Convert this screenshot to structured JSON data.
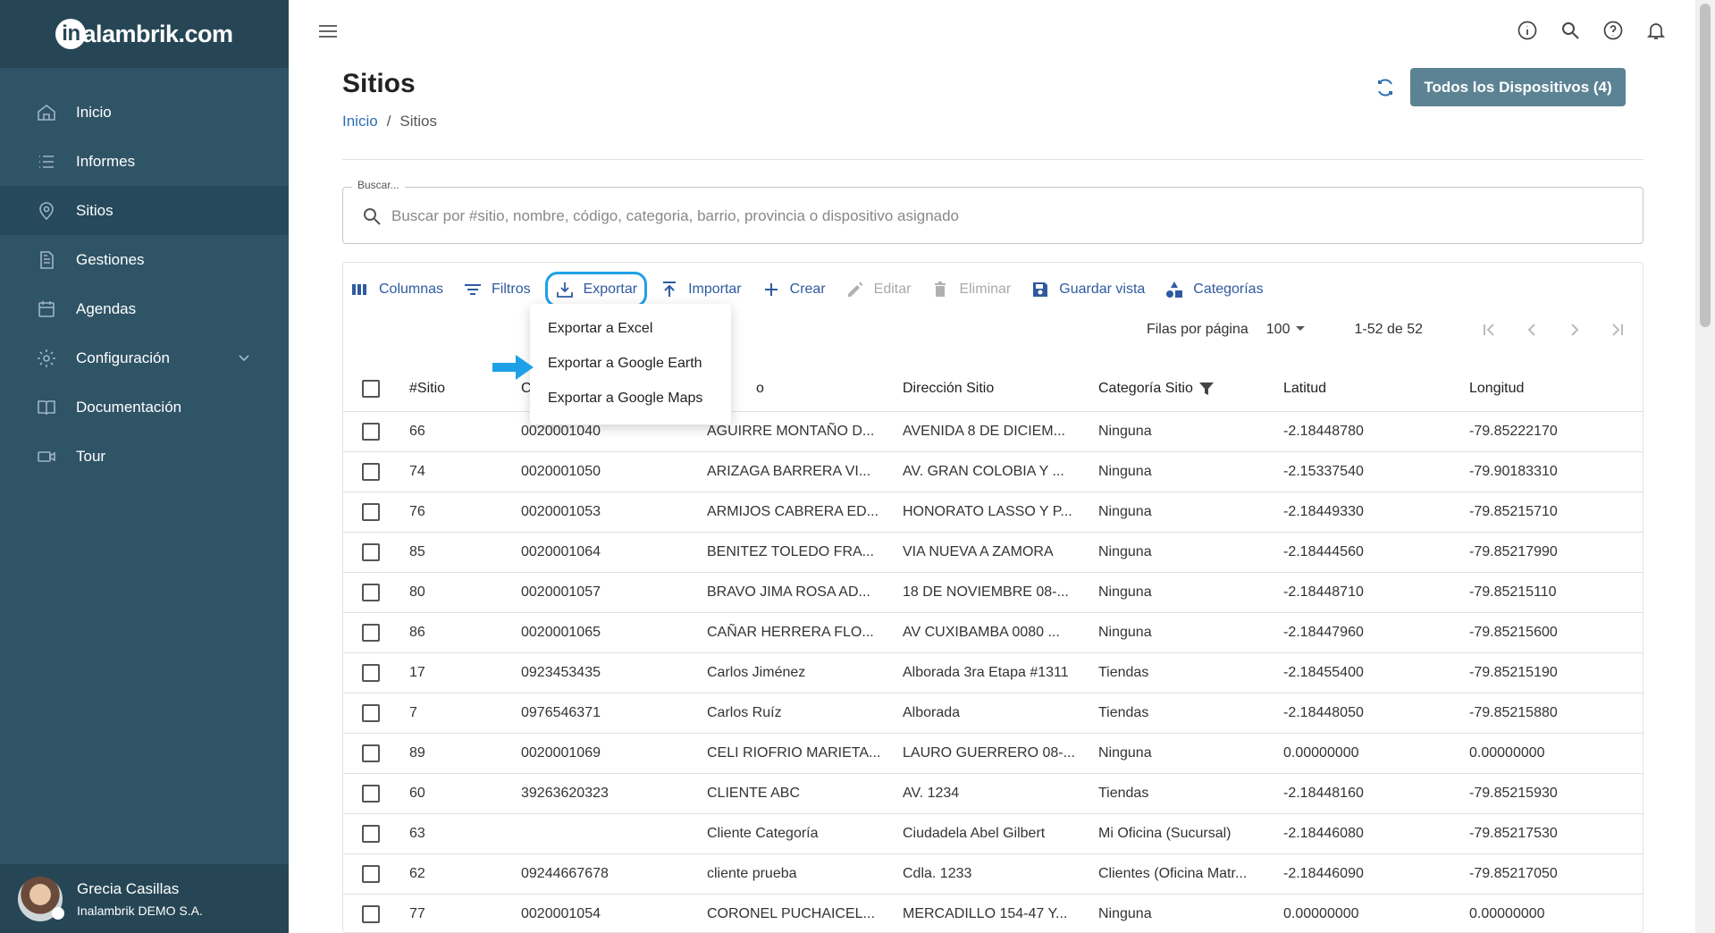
{
  "brand": {
    "logo_text": "alambrik.com",
    "logo_letter": "in"
  },
  "sidebar": {
    "items": [
      {
        "label": "Inicio",
        "icon": "home-icon"
      },
      {
        "label": "Informes",
        "icon": "list-icon"
      },
      {
        "label": "Sitios",
        "icon": "location-pin-icon",
        "active": true
      },
      {
        "label": "Gestiones",
        "icon": "document-icon"
      },
      {
        "label": "Agendas",
        "icon": "calendar-icon"
      },
      {
        "label": "Configuración",
        "icon": "gear-icon"
      },
      {
        "label": "Documentación",
        "icon": "book-icon"
      },
      {
        "label": "Tour",
        "icon": "video-icon"
      }
    ],
    "user": {
      "name": "Grecia Casillas",
      "company": "Inalambrik DEMO S.A."
    }
  },
  "header": {
    "title": "Sitios",
    "breadcrumb": {
      "home": "Inicio",
      "separator": "/",
      "current": "Sitios"
    },
    "devices_button": "Todos los Dispositivos (4)"
  },
  "search": {
    "label": "Buscar...",
    "placeholder": "Buscar por #sitio, nombre, código, categoria, barrio, provincia o dispositivo asignado"
  },
  "toolbar": {
    "columns": "Columnas",
    "filters": "Filtros",
    "export": "Exportar",
    "import": "Importar",
    "create": "Crear",
    "edit": "Editar",
    "delete": "Eliminar",
    "save_view": "Guardar vista",
    "categories": "Categorías"
  },
  "export_menu": {
    "items": [
      "Exportar a Excel",
      "Exportar a Google Earth",
      "Exportar a Google Maps"
    ]
  },
  "pager": {
    "rows_label": "Filas por página",
    "rows_value": "100",
    "range": "1-52 de 52"
  },
  "table": {
    "headers": {
      "id": "#Sitio",
      "code": "C",
      "name": "o",
      "address": "Dirección Sitio",
      "category": "Categoría Sitio",
      "lat": "Latitud",
      "lng": "Longitud"
    },
    "rows": [
      {
        "id": "66",
        "code": "0020001040",
        "name": "AGUIRRE MONTAÑO D...",
        "address": "AVENIDA 8 DE DICIEM...",
        "category": "Ninguna",
        "lat": "-2.18448780",
        "lng": "-79.85222170"
      },
      {
        "id": "74",
        "code": "0020001050",
        "name": "ARIZAGA BARRERA VI...",
        "address": "AV. GRAN COLOBIA Y ...",
        "category": "Ninguna",
        "lat": "-2.15337540",
        "lng": "-79.90183310"
      },
      {
        "id": "76",
        "code": "0020001053",
        "name": "ARMIJOS CABRERA ED...",
        "address": "HONORATO LASSO Y P...",
        "category": "Ninguna",
        "lat": "-2.18449330",
        "lng": "-79.85215710"
      },
      {
        "id": "85",
        "code": "0020001064",
        "name": "BENITEZ TOLEDO FRA...",
        "address": "VIA NUEVA A ZAMORA",
        "category": "Ninguna",
        "lat": "-2.18444560",
        "lng": "-79.85217990"
      },
      {
        "id": "80",
        "code": "0020001057",
        "name": "BRAVO JIMA ROSA AD...",
        "address": "18 DE NOVIEMBRE 08-...",
        "category": "Ninguna",
        "lat": "-2.18448710",
        "lng": "-79.85215110"
      },
      {
        "id": "86",
        "code": "0020001065",
        "name": "CAÑAR HERRERA FLO...",
        "address": "AV CUXIBAMBA 0080 ...",
        "category": "Ninguna",
        "lat": "-2.18447960",
        "lng": "-79.85215600"
      },
      {
        "id": "17",
        "code": "0923453435",
        "name": "Carlos Jiménez",
        "address": "Alborada 3ra Etapa #1311",
        "category": "Tiendas",
        "lat": "-2.18455400",
        "lng": "-79.85215190"
      },
      {
        "id": "7",
        "code": "0976546371",
        "name": "Carlos Ruíz",
        "address": "Alborada",
        "category": "Tiendas",
        "lat": "-2.18448050",
        "lng": "-79.85215880"
      },
      {
        "id": "89",
        "code": "0020001069",
        "name": "CELI RIOFRIO MARIETA...",
        "address": "LAURO GUERRERO 08-...",
        "category": "Ninguna",
        "lat": "0.00000000",
        "lng": "0.00000000"
      },
      {
        "id": "60",
        "code": "39263620323",
        "name": "CLIENTE ABC",
        "address": "AV. 1234",
        "category": "Tiendas",
        "lat": "-2.18448160",
        "lng": "-79.85215930"
      },
      {
        "id": "63",
        "code": "",
        "name": "Cliente Categoría",
        "address": "Ciudadela Abel Gilbert",
        "category": "Mi Oficina (Sucursal)",
        "lat": "-2.18446080",
        "lng": "-79.85217530"
      },
      {
        "id": "62",
        "code": "09244667678",
        "name": "cliente prueba",
        "address": "Cdla. 1233",
        "category": "Clientes (Oficina Matr...",
        "lat": "-2.18446090",
        "lng": "-79.85217050"
      },
      {
        "id": "77",
        "code": "0020001054",
        "name": "CORONEL PUCHAICEL...",
        "address": "MERCADILLO 154-47 Y...",
        "category": "Ninguna",
        "lat": "0.00000000",
        "lng": "0.00000000"
      }
    ]
  },
  "colors": {
    "sidebar": "#2f5466",
    "accent": "#2f5aa0",
    "highlight": "#1ea0e8",
    "button": "#5c8394"
  }
}
